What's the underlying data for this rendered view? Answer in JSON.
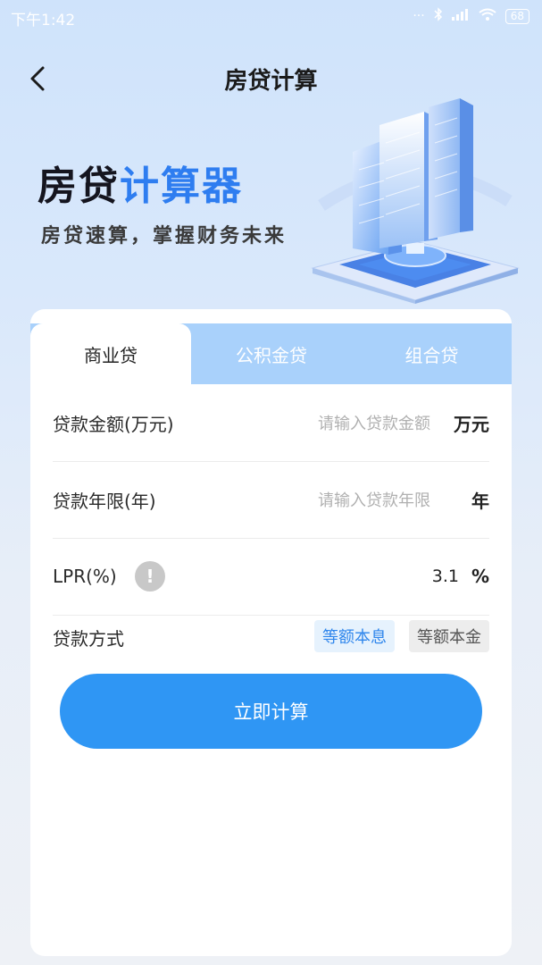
{
  "status_bar": {
    "time": "下午1:42",
    "battery": "68",
    "dots": "···"
  },
  "nav": {
    "title": "房贷计算"
  },
  "banner": {
    "title_part1": "房贷",
    "title_part2": "计算器",
    "subtitle": "房贷速算，掌握财务未来"
  },
  "tabs": [
    {
      "label": "商业贷",
      "active": true
    },
    {
      "label": "公积金贷",
      "active": false
    },
    {
      "label": "组合贷",
      "active": false
    }
  ],
  "form": {
    "amount": {
      "label": "贷款金额(万元)",
      "placeholder": "请输入贷款金额",
      "unit": "万元"
    },
    "term": {
      "label": "贷款年限(年)",
      "placeholder": "请输入贷款年限",
      "unit": "年"
    },
    "lpr": {
      "label": "LPR(%)",
      "value": "3.1",
      "unit": "%",
      "info_icon": "!"
    },
    "method": {
      "label": "贷款方式",
      "options": [
        "等额本息",
        "等额本金"
      ],
      "selected": "等额本息"
    }
  },
  "calculate_button": "立即计算",
  "colors": {
    "accent": "#2f96f4",
    "tab_bar": "#a9d1fb",
    "chip_selected_bg": "#e6f2fd"
  }
}
